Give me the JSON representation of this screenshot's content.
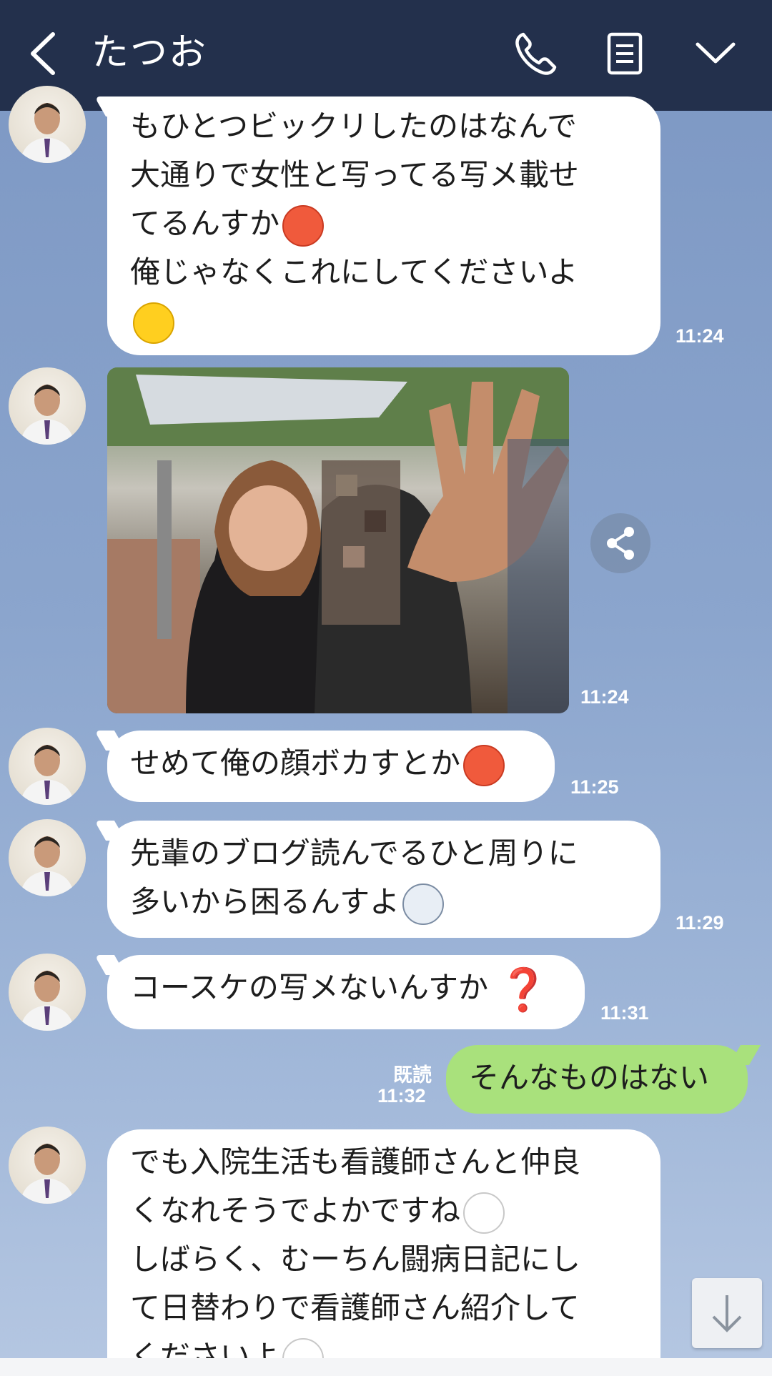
{
  "header": {
    "title": "たつお",
    "back_icon": "chevron-left-icon",
    "phone_icon": "phone-icon",
    "notes_icon": "notes-icon",
    "menu_icon": "chevron-down-icon"
  },
  "messages": [
    {
      "lines": [
        "もひとつビックリしたのはなんで",
        "大通りで女性と写ってる写メ載せ",
        "てるんすか",
        "俺じゃなくこれにしてくださいよ"
      ],
      "time": "11:24"
    },
    {
      "type": "photo",
      "time": "11:24"
    },
    {
      "text": "せめて俺の顔ボカすとか",
      "time": "11:25"
    },
    {
      "lines": [
        "先輩のブログ読んでるひと周りに",
        "多いから困るんすよ"
      ],
      "time": "11:29"
    },
    {
      "text": "コースケの写メないんすか",
      "qmark": "❓",
      "time": "11:31"
    },
    {
      "text": "そんなものはない",
      "read": "既読",
      "time": "11:32"
    },
    {
      "lines": [
        "でも入院生活も看護師さんと仲良",
        "くなれそうでよかですね",
        "しばらく、むーちん闘病日記にし",
        "て日替わりで看護師さん紹介して",
        "くださいよ"
      ]
    }
  ],
  "colors": {
    "header_bg": "#23304c",
    "chat_bg": "#8ba5cd",
    "own_bubble": "#a9e17c",
    "other_bubble": "#ffffff"
  }
}
